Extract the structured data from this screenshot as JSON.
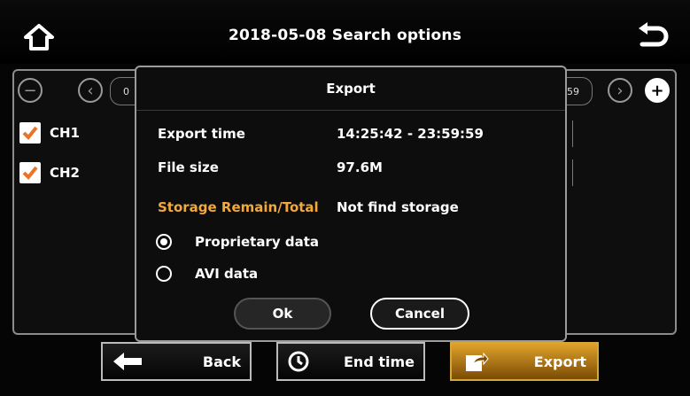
{
  "header": {
    "title": "2018-05-08  Search options",
    "home_icon": "home-icon",
    "back_icon": "return-icon"
  },
  "timeline": {
    "start_partial": "0",
    "end_partial": "59"
  },
  "channels": [
    {
      "label": "CH1",
      "checked": true
    },
    {
      "label": "CH2",
      "checked": true
    }
  ],
  "dialog": {
    "title": "Export",
    "export_time_label": "Export time",
    "export_time_value": "14:25:42 - 23:59:59",
    "file_size_label": "File size",
    "file_size_value": "97.6M",
    "storage_label": "Storage Remain/Total",
    "storage_value": "Not find storage",
    "options": [
      {
        "label": "Proprietary data",
        "selected": true
      },
      {
        "label": "AVI data",
        "selected": false
      }
    ],
    "ok_label": "Ok",
    "cancel_label": "Cancel"
  },
  "bottom_bar": {
    "back_label": "Back",
    "end_time_label": "End time",
    "export_label": "Export"
  },
  "colors": {
    "accent": "#f2a93b",
    "checkbox_mark": "#e8742a",
    "export_active": "#e0a22a"
  }
}
